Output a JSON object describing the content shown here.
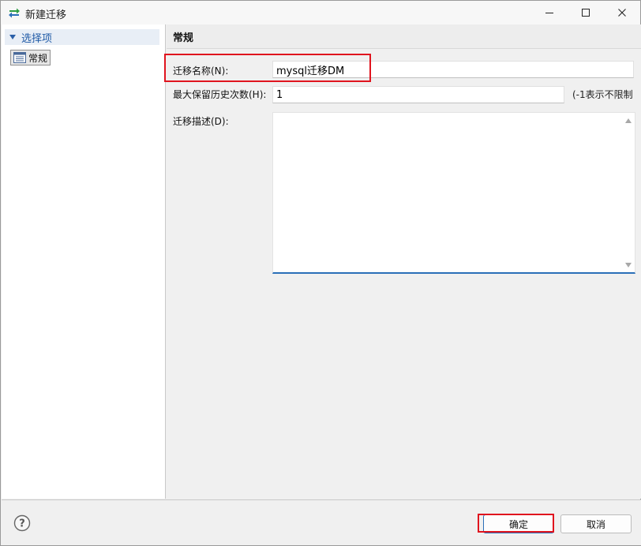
{
  "window": {
    "title": "新建迁移",
    "controls": {
      "minimize_icon": "minimize-icon",
      "maximize_icon": "maximize-icon",
      "close_icon": "close-icon"
    }
  },
  "sidebar": {
    "group_label": "选择项",
    "items": [
      {
        "label": "常规",
        "icon": "list-page-icon",
        "selected": true
      }
    ]
  },
  "section": {
    "title": "常规"
  },
  "form": {
    "name_label": "迁移名称(N):",
    "name_value": "mysql迁移DM",
    "history_label": "最大保留历史次数(H):",
    "history_value": "1",
    "history_hint": "(-1表示不限制",
    "description_label": "迁移描述(D):",
    "description_value": ""
  },
  "footer": {
    "help_icon": "help-icon",
    "ok_label": "确定",
    "cancel_label": "取消"
  },
  "colors": {
    "highlight_box": "#e0141e",
    "accent": "#2a6fb8",
    "sidebar_group": "#1f5aa6"
  }
}
